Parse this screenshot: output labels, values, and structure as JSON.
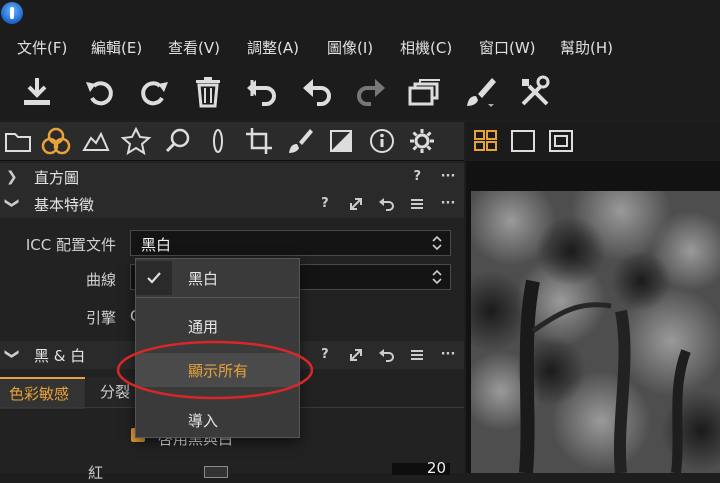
{
  "menu": [
    "文件(F)",
    "編輯(E)",
    "查看(V)",
    "調整(A)",
    "圖像(I)",
    "相機(C)",
    "窗口(W)",
    "幫助(H)"
  ],
  "toolbar_icons": [
    "download-icon",
    "rotate-left-icon",
    "rotate-right-icon",
    "trash-icon",
    "undo-all-icon",
    "undo-icon",
    "redo-icon",
    "stacked-windows-icon",
    "brush-icon",
    "tools-icon"
  ],
  "tool_tabs": [
    "folder-icon",
    "color-circles-icon",
    "exposure-icon",
    "star-icon",
    "magnifier-icon",
    "lens-icon",
    "crop-icon",
    "brush-icon",
    "bw-square-icon",
    "info-icon",
    "gear-icon"
  ],
  "sections": {
    "histogram": {
      "title": "直方圖",
      "help": "?",
      "more": "···"
    },
    "basic": {
      "title": "基本特徵",
      "help": "?",
      "more": "···"
    },
    "bw": {
      "title": "黑 & 白",
      "help": "?",
      "more": "···"
    }
  },
  "basic_fields": {
    "icc_label": "ICC 配置文件",
    "icc_value": "黑白",
    "curve_label": "曲線",
    "engine_label": "引擎",
    "engine_value_partial": "C"
  },
  "bw_tabs": {
    "active": "色彩敏感",
    "second": "分裂"
  },
  "bw_partial": {
    "checkbox_label_partial": "啓用黑與白",
    "slider_label_partial": "紅",
    "slider_value_partial": "20"
  },
  "dropdown": {
    "items": [
      {
        "label": "黑白",
        "checked": true
      },
      {
        "label": "通用",
        "checked": false
      },
      {
        "label": "顯示所有",
        "checked": false,
        "highlighted": true
      },
      {
        "label": "導入",
        "checked": false
      }
    ]
  },
  "colors": {
    "accent_orange": "#e8a23a",
    "highlight_red": "#d9262a"
  }
}
